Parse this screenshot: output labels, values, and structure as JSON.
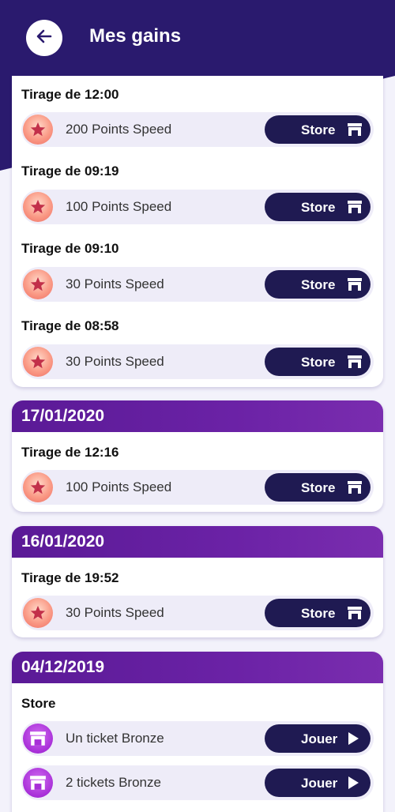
{
  "header": {
    "title": "Mes gains"
  },
  "colors": {
    "header_bg": "#2a1a6e",
    "accent": "#6b22a6",
    "button_bg": "#1f1a52"
  },
  "icons": {
    "back": "arrow-left-icon",
    "reward": "star-coin-icon",
    "store": "store-icon",
    "play": "play-icon"
  },
  "cards": [
    {
      "date": "",
      "groups": [
        {
          "title": "Tirage de 12:00",
          "items": [
            {
              "label": "200 Points Speed",
              "action": "Store"
            }
          ]
        },
        {
          "title": "Tirage de 09:19",
          "items": [
            {
              "label": "100 Points Speed",
              "action": "Store"
            }
          ]
        },
        {
          "title": "Tirage de 09:10",
          "items": [
            {
              "label": "30 Points Speed",
              "action": "Store"
            }
          ]
        },
        {
          "title": "Tirage de 08:58",
          "items": [
            {
              "label": "30 Points Speed",
              "action": "Store"
            }
          ]
        }
      ]
    },
    {
      "date": "17/01/2020",
      "groups": [
        {
          "title": "Tirage de 12:16",
          "items": [
            {
              "label": "100 Points Speed",
              "action": "Store"
            }
          ]
        }
      ]
    },
    {
      "date": "16/01/2020",
      "groups": [
        {
          "title": "Tirage de 19:52",
          "items": [
            {
              "label": "30 Points Speed",
              "action": "Store"
            }
          ]
        }
      ]
    },
    {
      "date": "04/12/2019",
      "groups": [
        {
          "title": "Store",
          "items": [
            {
              "label": "Un ticket Bronze",
              "action": "Jouer"
            },
            {
              "label": "2 tickets Bronze",
              "action": "Jouer"
            }
          ]
        }
      ]
    }
  ]
}
